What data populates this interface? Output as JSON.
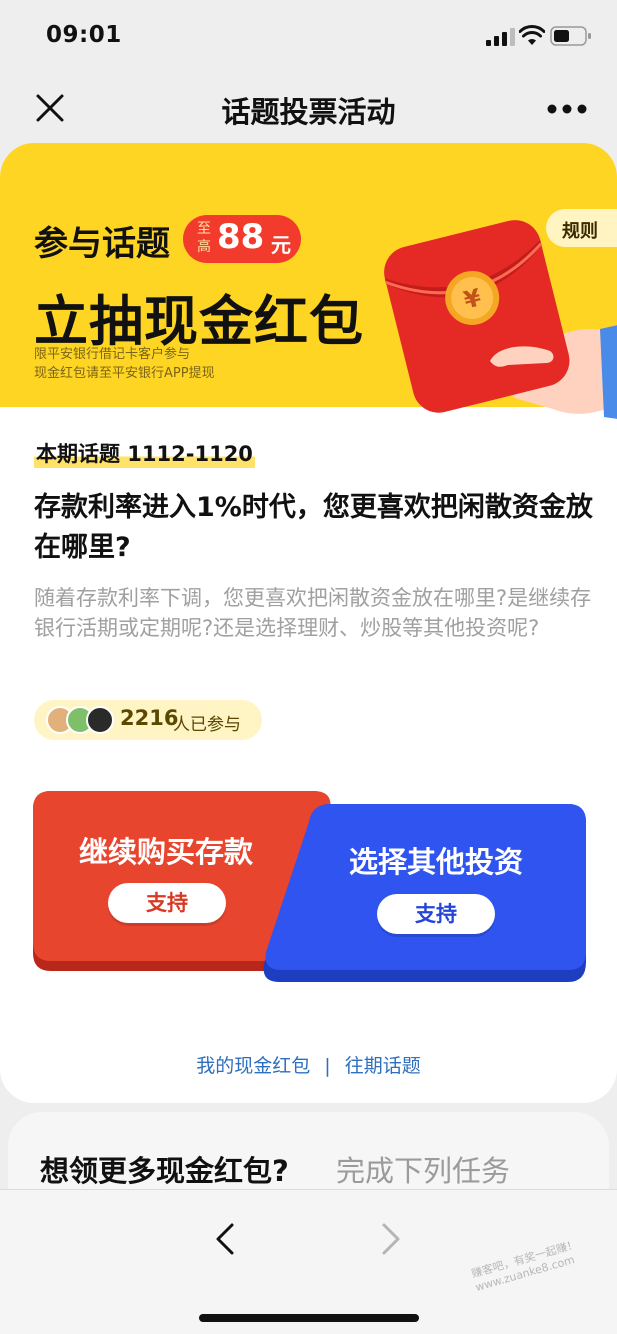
{
  "status_bar": {
    "time": "09:01"
  },
  "nav": {
    "title": "话题投票活动"
  },
  "banner": {
    "line1": "参与话题",
    "amount_prefix": "至高",
    "amount": "88",
    "amount_unit": "元",
    "line2": "立抽现金红包",
    "note1": "限平安银行借记卡客户参与",
    "note2": "现金红包请至平安银行APP提现",
    "rules": "规则"
  },
  "topic": {
    "tag": "本期话题 1112-1120",
    "question": "存款利率进入1%时代，您更喜欢把闲散资金放在哪里?",
    "description": "随着存款利率下调，您更喜欢把闲散资金放在哪里?是继续存银行活期或定期呢?还是选择理财、炒股等其他投资呢?"
  },
  "participants": {
    "count": "2216",
    "label": "人已参与"
  },
  "vote": {
    "left_label": "继续购买存款",
    "right_label": "选择其他投资",
    "support_left": "支持",
    "support_right": "支持",
    "left_color": "#e8452f",
    "right_color": "#2f54f0"
  },
  "links": {
    "my_red_packet": "我的现金红包",
    "past_topics": "往期话题",
    "separator": "|"
  },
  "more": {
    "title": "想领更多现金红包?",
    "subtitle": "完成下列任务"
  },
  "watermark": {
    "line1": "赚客吧，有奖一起赚！",
    "line2": "www.zuanke8.com"
  }
}
